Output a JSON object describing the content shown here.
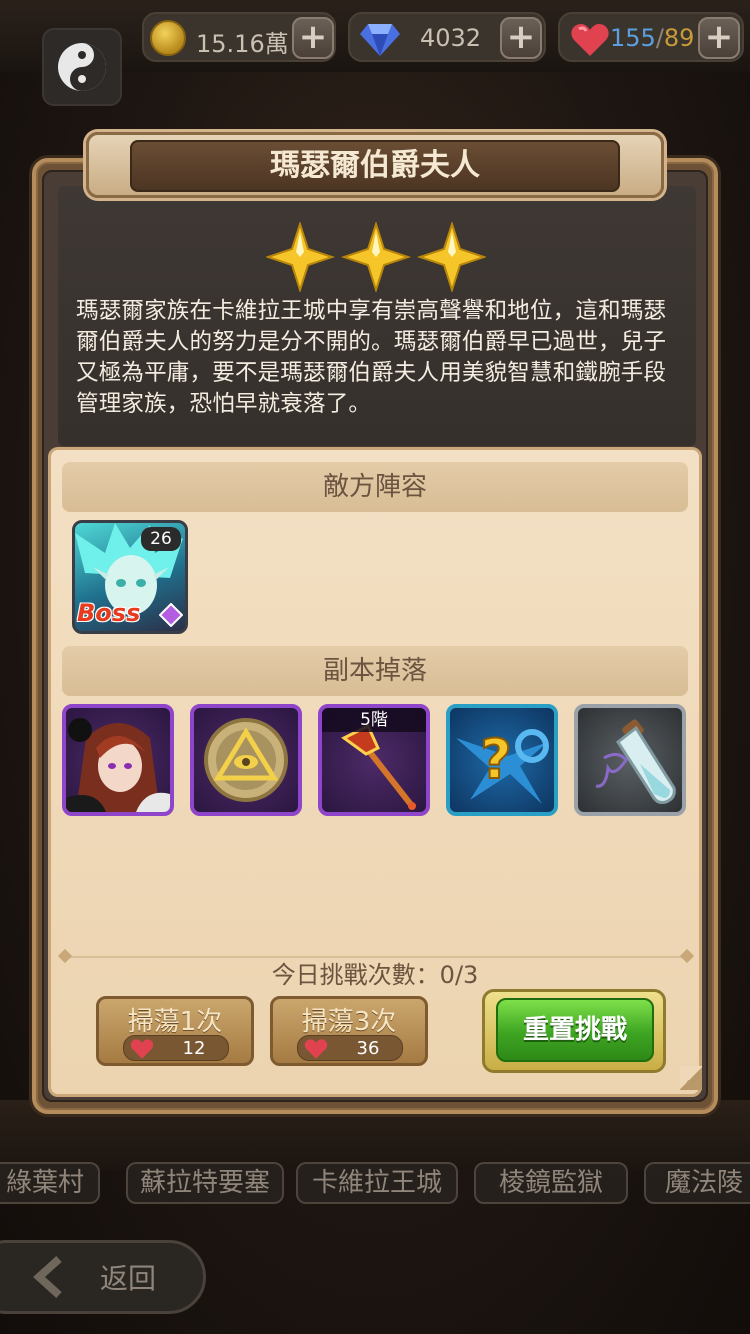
{
  "resources": {
    "gold": "15.16萬",
    "gems": "4032",
    "stamina_current": "155",
    "stamina_separator": "/",
    "stamina_max": "89",
    "plus": "+"
  },
  "stage_nav": {
    "items": [
      "綠葉村",
      "蘇拉特要塞",
      "卡維拉王城",
      "棱鏡監獄",
      "魔法陵"
    ],
    "back_label": "返回"
  },
  "dialog": {
    "title": "瑪瑟爾伯爵夫人",
    "stars": 3,
    "description": "瑪瑟爾家族在卡維拉王城中享有崇高聲譽和地位，這和瑪瑟爾伯爵夫人的努力是分不開的。瑪瑟爾伯爵早已過世，兒子又極為平庸，要不是瑪瑟爾伯爵夫人用美貌智慧和鐵腕手段管理家族，恐怕早就衰落了。",
    "enemy_section": "敵方陣容",
    "enemy": {
      "level": "26",
      "tag": "Boss"
    },
    "drops_section": "副本掉落",
    "drops": [
      {
        "name": "hero-portrait",
        "rarity": "purple"
      },
      {
        "name": "eye-emblem",
        "rarity": "purple"
      },
      {
        "name": "staff",
        "rarity": "purple",
        "tier": "5階"
      },
      {
        "name": "mystery-weapon",
        "rarity": "blue"
      },
      {
        "name": "potion-vial",
        "rarity": "gray"
      }
    ],
    "daily_challenges": "今日挑戰次數：0/3",
    "sweep1": {
      "label": "掃蕩1次",
      "cost": "12"
    },
    "sweep3": {
      "label": "掃蕩3次",
      "cost": "36"
    },
    "reset_label": "重置挑戰"
  }
}
